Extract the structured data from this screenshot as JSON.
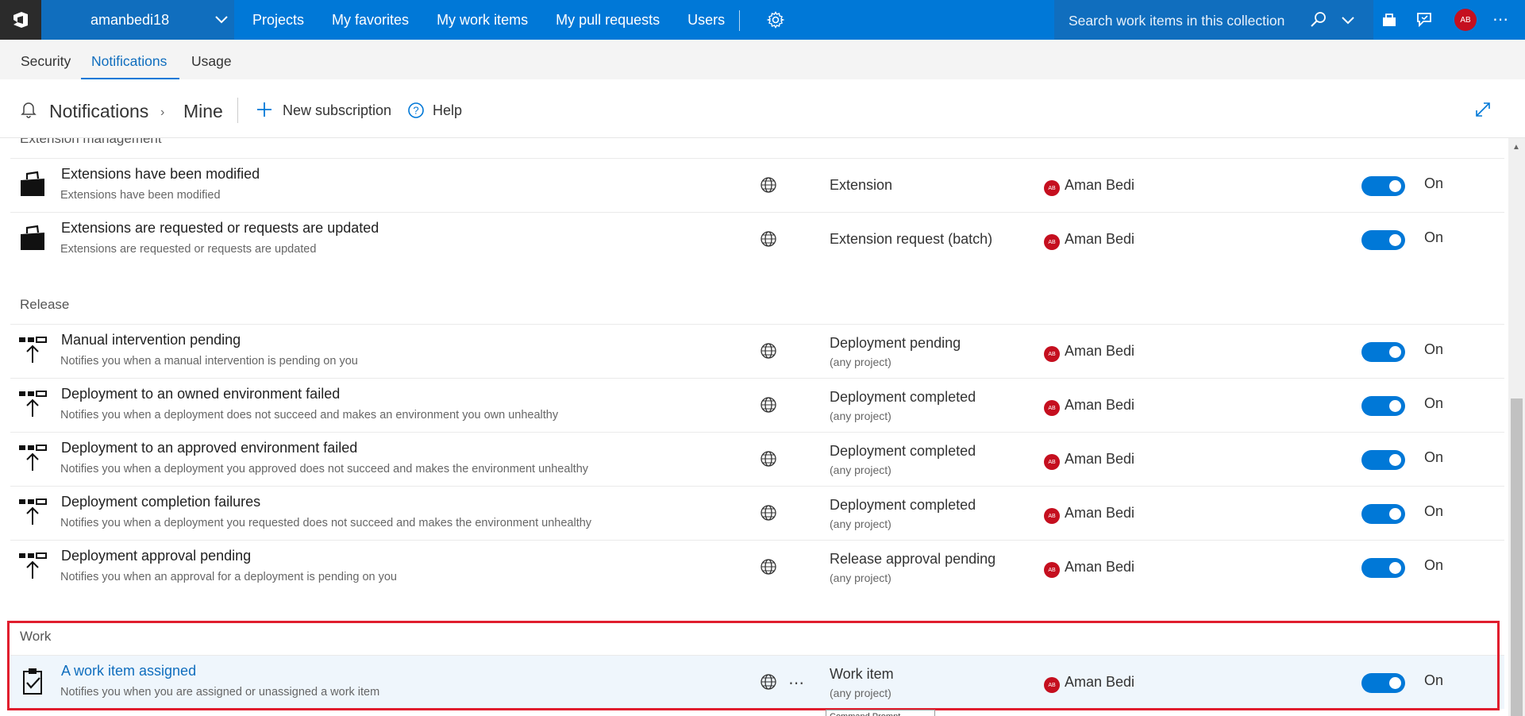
{
  "topbar": {
    "account": "amanbedi18",
    "nav": [
      "Projects",
      "My favorites",
      "My work items",
      "My pull requests",
      "Users"
    ],
    "search_placeholder": "Search work items in this collection",
    "avatar_initials": "AB",
    "brand_color": "#0078d7"
  },
  "subtabs": [
    "Security",
    "Notifications",
    "Usage"
  ],
  "active_subtab": "Notifications",
  "header": {
    "title": "Notifications",
    "breadcrumb": "Mine",
    "new_subscription": "New subscription",
    "help": "Help"
  },
  "sections": {
    "extension": {
      "title": "Extension management",
      "rows": [
        {
          "title": "Extensions have been modified",
          "desc": "Extensions have been modified",
          "type": "Extension",
          "scope": "",
          "owner": "Aman Bedi",
          "owner_initials": "AB",
          "state": "On"
        },
        {
          "title": "Extensions are requested or requests are updated",
          "desc": "Extensions are requested or requests are updated",
          "type": "Extension request (batch)",
          "scope": "",
          "owner": "Aman Bedi",
          "owner_initials": "AB",
          "state": "On"
        }
      ]
    },
    "release": {
      "title": "Release",
      "rows": [
        {
          "title": "Manual intervention pending",
          "desc": "Notifies you when a manual intervention is pending on you",
          "type": "Deployment pending",
          "scope": "(any project)",
          "owner": "Aman Bedi",
          "owner_initials": "AB",
          "state": "On"
        },
        {
          "title": "Deployment to an owned environment failed",
          "desc": "Notifies you when a deployment does not succeed and makes an environment you own unhealthy",
          "type": "Deployment completed",
          "scope": "(any project)",
          "owner": "Aman Bedi",
          "owner_initials": "AB",
          "state": "On"
        },
        {
          "title": "Deployment to an approved environment failed",
          "desc": "Notifies you when a deployment you approved does not succeed and makes the environment unhealthy",
          "type": "Deployment completed",
          "scope": "(any project)",
          "owner": "Aman Bedi",
          "owner_initials": "AB",
          "state": "On"
        },
        {
          "title": "Deployment completion failures",
          "desc": "Notifies you when a deployment you requested does not succeed and makes the environment unhealthy",
          "type": "Deployment completed",
          "scope": "(any project)",
          "owner": "Aman Bedi",
          "owner_initials": "AB",
          "state": "On"
        },
        {
          "title": "Deployment approval pending",
          "desc": "Notifies you when an approval for a deployment is pending on you",
          "type": "Release approval pending",
          "scope": "(any project)",
          "owner": "Aman Bedi",
          "owner_initials": "AB",
          "state": "On"
        }
      ]
    },
    "work": {
      "title": "Work",
      "rows": [
        {
          "title": "A work item assigned",
          "desc": "Notifies you when you are assigned or unassigned a work item",
          "type": "Work item",
          "scope": "(any project)",
          "owner": "Aman Bedi",
          "owner_initials": "AB",
          "state": "On"
        }
      ]
    }
  },
  "tooltip_fragment": "Command Prompt",
  "highlight_color": "#e01e2e"
}
